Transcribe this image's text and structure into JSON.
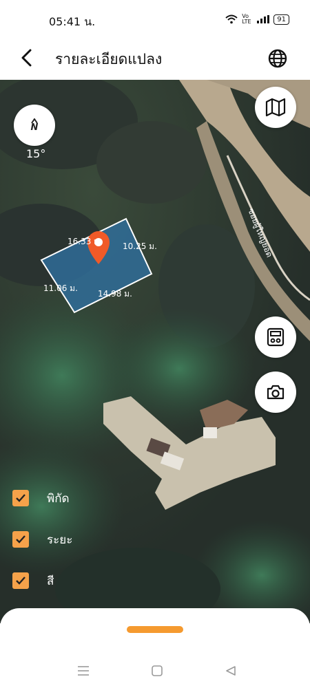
{
  "status": {
    "time": "05:41 น.",
    "network": "Vo LTE",
    "battery": "91"
  },
  "header": {
    "title": "รายละเอียดแปลง"
  },
  "map": {
    "compass_letter": "N",
    "rotation": "15°",
    "road_name": "ซอยผู้ใหญ่ยอด",
    "plot": {
      "side_top": "16.33 ม.",
      "side_right": "10.25 ม.",
      "side_left": "11.06 ม.",
      "side_bottom": "14.98 ม.",
      "fill_color": "#2f6f9f",
      "pin_color": "#f05a28"
    }
  },
  "layers": [
    {
      "label": "พิกัด",
      "checked": true
    },
    {
      "label": "ระยะ",
      "checked": true
    },
    {
      "label": "สี",
      "checked": true
    }
  ],
  "colors": {
    "accent": "#f59a2f",
    "checkbox": "#f5a24a"
  }
}
